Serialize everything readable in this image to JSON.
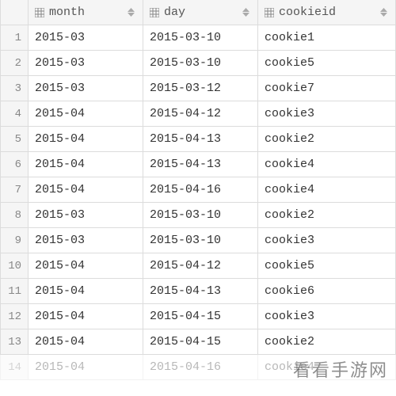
{
  "chart_data": {
    "type": "table",
    "columns": [
      "month",
      "day",
      "cookieid"
    ],
    "rows": [
      [
        "2015-03",
        "2015-03-10",
        "cookie1"
      ],
      [
        "2015-03",
        "2015-03-10",
        "cookie5"
      ],
      [
        "2015-03",
        "2015-03-12",
        "cookie7"
      ],
      [
        "2015-04",
        "2015-04-12",
        "cookie3"
      ],
      [
        "2015-04",
        "2015-04-13",
        "cookie2"
      ],
      [
        "2015-04",
        "2015-04-13",
        "cookie4"
      ],
      [
        "2015-04",
        "2015-04-16",
        "cookie4"
      ],
      [
        "2015-03",
        "2015-03-10",
        "cookie2"
      ],
      [
        "2015-03",
        "2015-03-10",
        "cookie3"
      ],
      [
        "2015-04",
        "2015-04-12",
        "cookie5"
      ],
      [
        "2015-04",
        "2015-04-13",
        "cookie6"
      ],
      [
        "2015-04",
        "2015-04-15",
        "cookie3"
      ],
      [
        "2015-04",
        "2015-04-15",
        "cookie2"
      ],
      [
        "2015-04",
        "2015-04-16",
        "cookie4"
      ]
    ]
  },
  "table": {
    "columns": {
      "month": "month",
      "day": "day",
      "cookieid": "cookieid"
    },
    "rownums": [
      "1",
      "2",
      "3",
      "4",
      "5",
      "6",
      "7",
      "8",
      "9",
      "10",
      "11",
      "12",
      "13",
      "14"
    ],
    "rows": [
      {
        "month": "2015-03",
        "day": "2015-03-10",
        "cookieid": "cookie1"
      },
      {
        "month": "2015-03",
        "day": "2015-03-10",
        "cookieid": "cookie5"
      },
      {
        "month": "2015-03",
        "day": "2015-03-12",
        "cookieid": "cookie7"
      },
      {
        "month": "2015-04",
        "day": "2015-04-12",
        "cookieid": "cookie3"
      },
      {
        "month": "2015-04",
        "day": "2015-04-13",
        "cookieid": "cookie2"
      },
      {
        "month": "2015-04",
        "day": "2015-04-13",
        "cookieid": "cookie4"
      },
      {
        "month": "2015-04",
        "day": "2015-04-16",
        "cookieid": "cookie4"
      },
      {
        "month": "2015-03",
        "day": "2015-03-10",
        "cookieid": "cookie2"
      },
      {
        "month": "2015-03",
        "day": "2015-03-10",
        "cookieid": "cookie3"
      },
      {
        "month": "2015-04",
        "day": "2015-04-12",
        "cookieid": "cookie5"
      },
      {
        "month": "2015-04",
        "day": "2015-04-13",
        "cookieid": "cookie6"
      },
      {
        "month": "2015-04",
        "day": "2015-04-15",
        "cookieid": "cookie3"
      },
      {
        "month": "2015-04",
        "day": "2015-04-15",
        "cookieid": "cookie2"
      },
      {
        "month": "2015-04",
        "day": "2015-04-16",
        "cookieid": "cookie4"
      }
    ]
  },
  "watermark": "看看手游网"
}
